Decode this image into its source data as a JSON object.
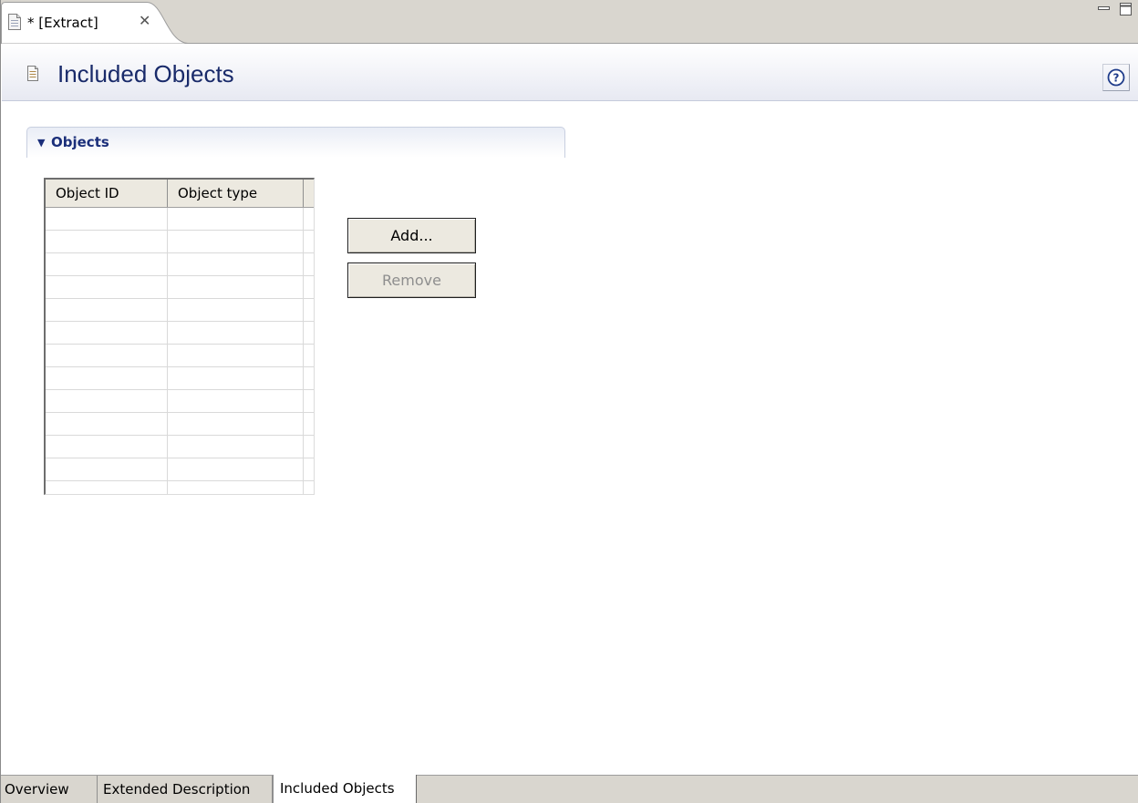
{
  "editor_tab": {
    "title": "* [Extract]",
    "close_icon": "close-icon"
  },
  "window_controls": {
    "minimize_icon": "minimize-icon",
    "maximize_icon": "maximize-icon"
  },
  "header": {
    "icon": "document-icon",
    "title": "Included Objects",
    "help_icon": "help-icon"
  },
  "section": {
    "title": "Objects",
    "expanded": true,
    "twistie_glyph": "▼"
  },
  "table": {
    "columns": [
      {
        "label": "Object ID"
      },
      {
        "label": "Object type"
      }
    ],
    "rows": [
      [
        "",
        ""
      ],
      [
        "",
        ""
      ],
      [
        "",
        ""
      ],
      [
        "",
        ""
      ],
      [
        "",
        ""
      ],
      [
        "",
        ""
      ],
      [
        "",
        ""
      ],
      [
        "",
        ""
      ],
      [
        "",
        ""
      ],
      [
        "",
        ""
      ],
      [
        "",
        ""
      ],
      [
        "",
        ""
      ],
      [
        "",
        ""
      ]
    ]
  },
  "buttons": {
    "add_label": "Add...",
    "remove_label": "Remove",
    "remove_enabled": false
  },
  "page_tabs": [
    {
      "label": "Overview",
      "active": false
    },
    {
      "label": "Extended Description",
      "active": false
    },
    {
      "label": "Included Objects",
      "active": true
    }
  ],
  "colors": {
    "title_blue": "#192a6a",
    "section_blue": "#1b2f7a",
    "chrome_gray": "#d9d6cf"
  }
}
